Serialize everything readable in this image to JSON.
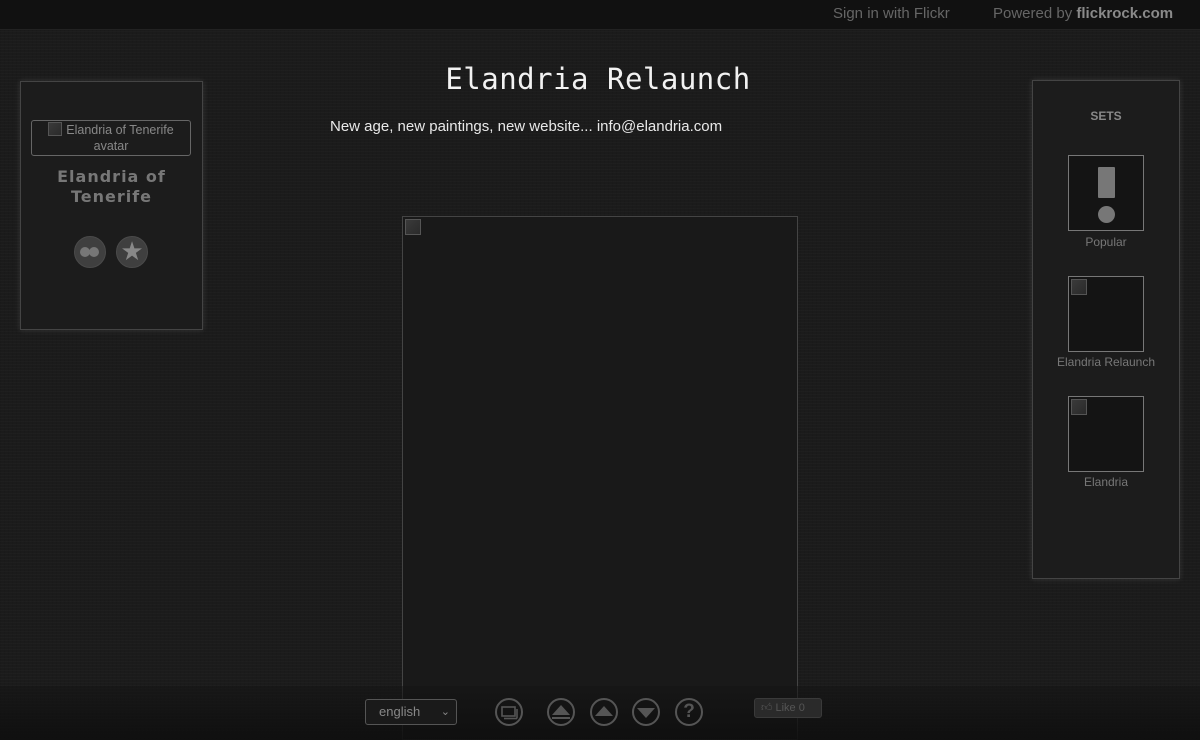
{
  "header": {
    "sign_in": "Sign in with Flickr",
    "powered_prefix": "Powered by ",
    "powered_brand": "flickrock.com"
  },
  "page": {
    "title": "Elandria Relaunch",
    "subtitle": "New age, new paintings, new website... info@elandria.com"
  },
  "profile": {
    "avatar_alt": "Elandria of Tenerife avatar",
    "name": "Elandria of Tenerife",
    "icons": [
      "flickr-icon",
      "star-icon"
    ]
  },
  "sets": {
    "heading": "SETS",
    "items": [
      {
        "label": "Popular",
        "icon": "exclamation-icon"
      },
      {
        "label": "Elandria Relaunch",
        "icon": "broken-image-icon"
      },
      {
        "label": "Elandria",
        "icon": "broken-image-icon"
      }
    ]
  },
  "footer": {
    "language": "english",
    "controls": [
      "slideshow-icon",
      "arrow-up-icon",
      "arrow-up-icon",
      "arrow-down-icon",
      "help-icon"
    ],
    "help_glyph": "?",
    "like_label": "Like 0"
  },
  "colors": {
    "background": "#1b1b1b",
    "panel_border": "#444444",
    "muted_text": "#777777",
    "title_text": "#f2f2f2"
  }
}
